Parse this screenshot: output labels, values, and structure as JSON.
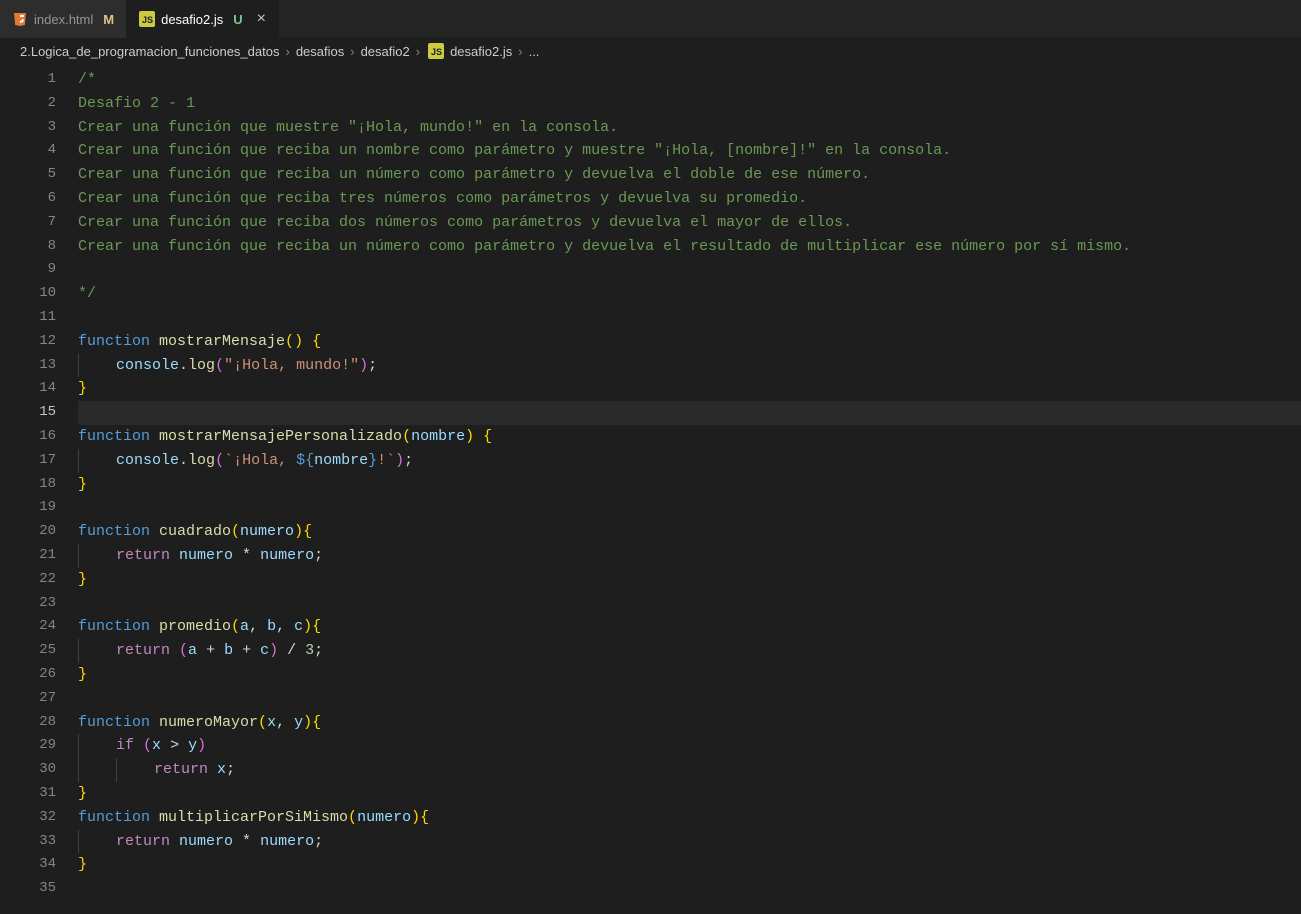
{
  "tabs": [
    {
      "name": "index.html",
      "icon": "html",
      "git": "M",
      "active": false
    },
    {
      "name": "desafio2.js",
      "icon": "js",
      "git": "U",
      "active": true
    }
  ],
  "breadcrumbs": {
    "parts": [
      "2.Logica_de_programacion_funciones_datos",
      "desafios",
      "desafio2"
    ],
    "file_icon": "js",
    "file": "desafio2.js",
    "trailing": "..."
  },
  "active_line": 15,
  "code_lines": [
    [
      {
        "t": "/*",
        "c": "c-comment"
      }
    ],
    [
      {
        "t": "Desafio 2 - 1",
        "c": "c-comment"
      }
    ],
    [
      {
        "t": "Crear una función que muestre \"¡Hola, mundo!\" en la consola.",
        "c": "c-comment"
      }
    ],
    [
      {
        "t": "Crear una función que reciba un nombre como parámetro y muestre \"¡Hola, [nombre]!\" en la consola.",
        "c": "c-comment"
      }
    ],
    [
      {
        "t": "Crear una función que reciba un número como parámetro y devuelva el doble de ese número.",
        "c": "c-comment"
      }
    ],
    [
      {
        "t": "Crear una función que reciba tres números como parámetros y devuelva su promedio.",
        "c": "c-comment"
      }
    ],
    [
      {
        "t": "Crear una función que reciba dos números como parámetros y devuelva el mayor de ellos.",
        "c": "c-comment"
      }
    ],
    [
      {
        "t": "Crear una función que reciba un número como parámetro y devuelva el resultado de multiplicar ese número por sí mismo.",
        "c": "c-comment"
      }
    ],
    [],
    [
      {
        "t": "*/",
        "c": "c-comment"
      }
    ],
    [],
    [
      {
        "t": "function ",
        "c": "c-keyword"
      },
      {
        "t": "mostrarMensaje",
        "c": "c-func"
      },
      {
        "t": "(",
        "c": "c-brace"
      },
      {
        "t": ")",
        "c": "c-brace"
      },
      {
        "t": " ",
        "c": "c-punc"
      },
      {
        "t": "{",
        "c": "c-brace"
      }
    ],
    [
      {
        "t": "    ",
        "c": "",
        "guide": true
      },
      {
        "t": "console",
        "c": "c-obj"
      },
      {
        "t": ".",
        "c": "c-punc"
      },
      {
        "t": "log",
        "c": "c-func"
      },
      {
        "t": "(",
        "c": "c-brace2"
      },
      {
        "t": "\"¡Hola, mundo!\"",
        "c": "c-string"
      },
      {
        "t": ")",
        "c": "c-brace2"
      },
      {
        "t": ";",
        "c": "c-punc"
      }
    ],
    [
      {
        "t": "}",
        "c": "c-brace"
      }
    ],
    [],
    [
      {
        "t": "function ",
        "c": "c-keyword"
      },
      {
        "t": "mostrarMensajePersonalizado",
        "c": "c-func"
      },
      {
        "t": "(",
        "c": "c-brace"
      },
      {
        "t": "nombre",
        "c": "c-param"
      },
      {
        "t": ")",
        "c": "c-brace"
      },
      {
        "t": " ",
        "c": "c-punc"
      },
      {
        "t": "{",
        "c": "c-brace"
      }
    ],
    [
      {
        "t": "    ",
        "c": "",
        "guide": true
      },
      {
        "t": "console",
        "c": "c-obj"
      },
      {
        "t": ".",
        "c": "c-punc"
      },
      {
        "t": "log",
        "c": "c-func"
      },
      {
        "t": "(",
        "c": "c-brace2"
      },
      {
        "t": "`¡Hola, ",
        "c": "c-string"
      },
      {
        "t": "${",
        "c": "c-templ"
      },
      {
        "t": "nombre",
        "c": "c-var"
      },
      {
        "t": "}",
        "c": "c-templ"
      },
      {
        "t": "!`",
        "c": "c-string"
      },
      {
        "t": ")",
        "c": "c-brace2"
      },
      {
        "t": ";",
        "c": "c-punc"
      }
    ],
    [
      {
        "t": "}",
        "c": "c-brace"
      }
    ],
    [],
    [
      {
        "t": "function ",
        "c": "c-keyword"
      },
      {
        "t": "cuadrado",
        "c": "c-func"
      },
      {
        "t": "(",
        "c": "c-brace"
      },
      {
        "t": "numero",
        "c": "c-param"
      },
      {
        "t": ")",
        "c": "c-brace"
      },
      {
        "t": "{",
        "c": "c-brace"
      }
    ],
    [
      {
        "t": "    ",
        "c": "",
        "guide": true
      },
      {
        "t": "return ",
        "c": "c-control"
      },
      {
        "t": "numero",
        "c": "c-var"
      },
      {
        "t": " * ",
        "c": "c-punc"
      },
      {
        "t": "numero",
        "c": "c-var"
      },
      {
        "t": ";",
        "c": "c-punc"
      }
    ],
    [
      {
        "t": "}",
        "c": "c-brace"
      }
    ],
    [],
    [
      {
        "t": "function ",
        "c": "c-keyword"
      },
      {
        "t": "promedio",
        "c": "c-func"
      },
      {
        "t": "(",
        "c": "c-brace"
      },
      {
        "t": "a",
        "c": "c-param"
      },
      {
        "t": ", ",
        "c": "c-punc"
      },
      {
        "t": "b",
        "c": "c-param"
      },
      {
        "t": ", ",
        "c": "c-punc"
      },
      {
        "t": "c",
        "c": "c-param"
      },
      {
        "t": ")",
        "c": "c-brace"
      },
      {
        "t": "{",
        "c": "c-brace"
      }
    ],
    [
      {
        "t": "    ",
        "c": "",
        "guide": true
      },
      {
        "t": "return ",
        "c": "c-control"
      },
      {
        "t": "(",
        "c": "c-brace2"
      },
      {
        "t": "a",
        "c": "c-var"
      },
      {
        "t": " + ",
        "c": "c-punc"
      },
      {
        "t": "b",
        "c": "c-var"
      },
      {
        "t": " + ",
        "c": "c-punc"
      },
      {
        "t": "c",
        "c": "c-var"
      },
      {
        "t": ")",
        "c": "c-brace2"
      },
      {
        "t": " / ",
        "c": "c-punc"
      },
      {
        "t": "3",
        "c": "c-num"
      },
      {
        "t": ";",
        "c": "c-punc"
      }
    ],
    [
      {
        "t": "}",
        "c": "c-brace"
      }
    ],
    [],
    [
      {
        "t": "function ",
        "c": "c-keyword"
      },
      {
        "t": "numeroMayor",
        "c": "c-func"
      },
      {
        "t": "(",
        "c": "c-brace"
      },
      {
        "t": "x",
        "c": "c-param"
      },
      {
        "t": ", ",
        "c": "c-punc"
      },
      {
        "t": "y",
        "c": "c-param"
      },
      {
        "t": ")",
        "c": "c-brace"
      },
      {
        "t": "{",
        "c": "c-brace"
      }
    ],
    [
      {
        "t": "    ",
        "c": "",
        "guide": true
      },
      {
        "t": "if ",
        "c": "c-control"
      },
      {
        "t": "(",
        "c": "c-brace2"
      },
      {
        "t": "x",
        "c": "c-var"
      },
      {
        "t": " > ",
        "c": "c-punc"
      },
      {
        "t": "y",
        "c": "c-var"
      },
      {
        "t": ")",
        "c": "c-brace2"
      }
    ],
    [
      {
        "t": "    ",
        "c": "",
        "guide": true
      },
      {
        "t": "    ",
        "c": "",
        "guide": true
      },
      {
        "t": "return ",
        "c": "c-control"
      },
      {
        "t": "x",
        "c": "c-var"
      },
      {
        "t": ";",
        "c": "c-punc"
      }
    ],
    [
      {
        "t": "}",
        "c": "c-brace"
      }
    ],
    [
      {
        "t": "function ",
        "c": "c-keyword"
      },
      {
        "t": "multiplicarPorSiMismo",
        "c": "c-func"
      },
      {
        "t": "(",
        "c": "c-brace"
      },
      {
        "t": "numero",
        "c": "c-param"
      },
      {
        "t": ")",
        "c": "c-brace"
      },
      {
        "t": "{",
        "c": "c-brace"
      }
    ],
    [
      {
        "t": "    ",
        "c": "",
        "guide": true
      },
      {
        "t": "return ",
        "c": "c-control"
      },
      {
        "t": "numero",
        "c": "c-var"
      },
      {
        "t": " * ",
        "c": "c-punc"
      },
      {
        "t": "numero",
        "c": "c-var"
      },
      {
        "t": ";",
        "c": "c-punc"
      }
    ],
    [
      {
        "t": "}",
        "c": "c-brace"
      }
    ],
    []
  ]
}
